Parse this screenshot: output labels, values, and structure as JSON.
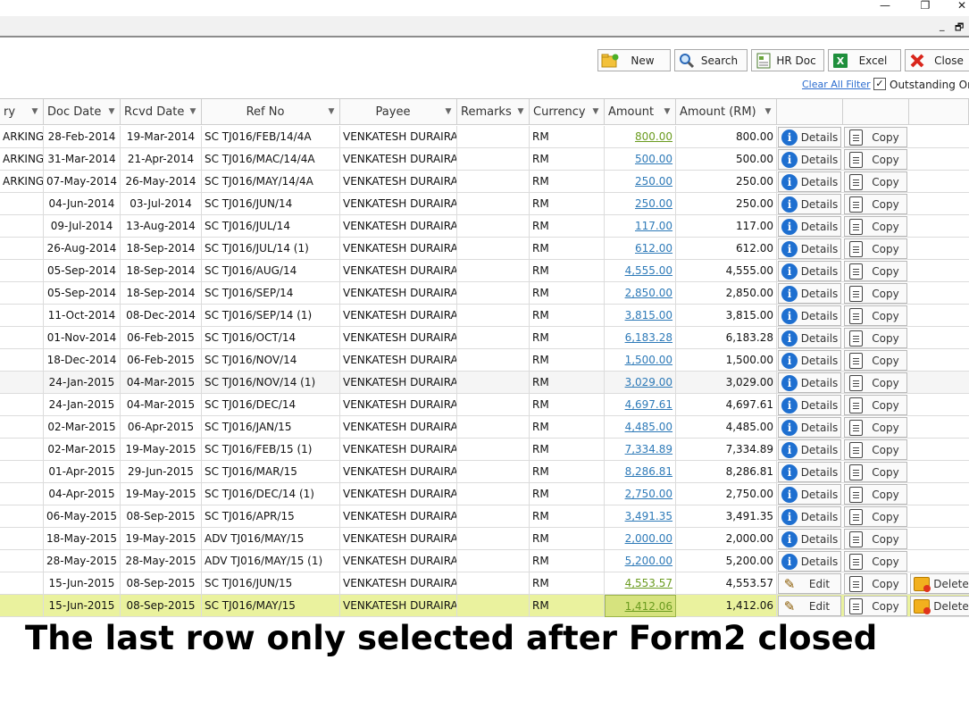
{
  "window": {
    "minimize": "—",
    "restore": "❐",
    "close": "✕",
    "mdi_minimize": "_",
    "mdi_restore": "🗗"
  },
  "toolbar": {
    "new_label": "New",
    "search_label": "Search",
    "hrdoc_label": "HR Doc",
    "excel_label": "Excel",
    "close_label": "Close"
  },
  "filter": {
    "clear_label": "Clear All Filter",
    "outstanding_label": "Outstanding Only",
    "outstanding_checked": "✓"
  },
  "columns": [
    {
      "key": "status",
      "label": "ry"
    },
    {
      "key": "doc_date",
      "label": "Doc Date"
    },
    {
      "key": "rcvd_date",
      "label": "Rcvd Date"
    },
    {
      "key": "ref_no",
      "label": "Ref No"
    },
    {
      "key": "payee",
      "label": "Payee"
    },
    {
      "key": "remarks",
      "label": "Remarks"
    },
    {
      "key": "currency",
      "label": "Currency"
    },
    {
      "key": "amount",
      "label": "Amount"
    },
    {
      "key": "amount_rm",
      "label": "Amount (RM)"
    }
  ],
  "buttons": {
    "details": "Details",
    "copy": "Copy",
    "edit": "Edit",
    "delete": "Delete"
  },
  "rows": [
    {
      "status": "ARKING",
      "doc_date": "28-Feb-2014",
      "rcvd_date": "19-Mar-2014",
      "ref_no": "SC TJ016/FEB/14/4A",
      "payee": "VENKATESH DURAIRAJ",
      "remarks": "",
      "currency": "RM",
      "amount": "800.00",
      "amount_rm": "800.00",
      "action": "Details",
      "can_delete": false
    },
    {
      "status": "ARKING",
      "doc_date": "31-Mar-2014",
      "rcvd_date": "21-Apr-2014",
      "ref_no": "SC TJ016/MAC/14/4A",
      "payee": "VENKATESH DURAIRAJ",
      "remarks": "",
      "currency": "RM",
      "amount": "500.00",
      "amount_rm": "500.00",
      "action": "Details",
      "can_delete": false
    },
    {
      "status": "ARKING",
      "doc_date": "07-May-2014",
      "rcvd_date": "26-May-2014",
      "ref_no": "SC TJ016/MAY/14/4A",
      "payee": "VENKATESH DURAIRAJ",
      "remarks": "",
      "currency": "RM",
      "amount": "250.00",
      "amount_rm": "250.00",
      "action": "Details",
      "can_delete": false
    },
    {
      "status": "",
      "doc_date": "04-Jun-2014",
      "rcvd_date": "03-Jul-2014",
      "ref_no": "SC TJ016/JUN/14",
      "payee": "VENKATESH DURAIRAJ",
      "remarks": "",
      "currency": "RM",
      "amount": "250.00",
      "amount_rm": "250.00",
      "action": "Details",
      "can_delete": false
    },
    {
      "status": "",
      "doc_date": "09-Jul-2014",
      "rcvd_date": "13-Aug-2014",
      "ref_no": "SC TJ016/JUL/14",
      "payee": "VENKATESH DURAIRAJ",
      "remarks": "",
      "currency": "RM",
      "amount": "117.00",
      "amount_rm": "117.00",
      "action": "Details",
      "can_delete": false
    },
    {
      "status": "",
      "doc_date": "26-Aug-2014",
      "rcvd_date": "18-Sep-2014",
      "ref_no": "SC TJ016/JUL/14 (1)",
      "payee": "VENKATESH DURAIRAJ",
      "remarks": "",
      "currency": "RM",
      "amount": "612.00",
      "amount_rm": "612.00",
      "action": "Details",
      "can_delete": false
    },
    {
      "status": "",
      "doc_date": "05-Sep-2014",
      "rcvd_date": "18-Sep-2014",
      "ref_no": "SC TJ016/AUG/14",
      "payee": "VENKATESH DURAIRAJ",
      "remarks": "",
      "currency": "RM",
      "amount": "4,555.00",
      "amount_rm": "4,555.00",
      "action": "Details",
      "can_delete": false
    },
    {
      "status": "",
      "doc_date": "05-Sep-2014",
      "rcvd_date": "18-Sep-2014",
      "ref_no": "SC TJ016/SEP/14",
      "payee": "VENKATESH DURAIRAJ",
      "remarks": "",
      "currency": "RM",
      "amount": "2,850.00",
      "amount_rm": "2,850.00",
      "action": "Details",
      "can_delete": false
    },
    {
      "status": "",
      "doc_date": "11-Oct-2014",
      "rcvd_date": "08-Dec-2014",
      "ref_no": "SC TJ016/SEP/14 (1)",
      "payee": "VENKATESH DURAIRAJ",
      "remarks": "",
      "currency": "RM",
      "amount": "3,815.00",
      "amount_rm": "3,815.00",
      "action": "Details",
      "can_delete": false
    },
    {
      "status": "",
      "doc_date": "01-Nov-2014",
      "rcvd_date": "06-Feb-2015",
      "ref_no": "SC TJ016/OCT/14",
      "payee": "VENKATESH DURAIRAJ",
      "remarks": "",
      "currency": "RM",
      "amount": "6,183.28",
      "amount_rm": "6,183.28",
      "action": "Details",
      "can_delete": false
    },
    {
      "status": "",
      "doc_date": "18-Dec-2014",
      "rcvd_date": "06-Feb-2015",
      "ref_no": "SC TJ016/NOV/14",
      "payee": "VENKATESH DURAIRAJ",
      "remarks": "",
      "currency": "RM",
      "amount": "1,500.00",
      "amount_rm": "1,500.00",
      "action": "Details",
      "can_delete": false
    },
    {
      "status": "",
      "doc_date": "24-Jan-2015",
      "rcvd_date": "04-Mar-2015",
      "ref_no": "SC TJ016/NOV/14 (1)",
      "payee": "VENKATESH DURAIRAJ",
      "remarks": "",
      "currency": "RM",
      "amount": "3,029.00",
      "amount_rm": "3,029.00",
      "action": "Details",
      "can_delete": false
    },
    {
      "status": "",
      "doc_date": "24-Jan-2015",
      "rcvd_date": "04-Mar-2015",
      "ref_no": "SC TJ016/DEC/14",
      "payee": "VENKATESH DURAIRAJ",
      "remarks": "",
      "currency": "RM",
      "amount": "4,697.61",
      "amount_rm": "4,697.61",
      "action": "Details",
      "can_delete": false
    },
    {
      "status": "",
      "doc_date": "02-Mar-2015",
      "rcvd_date": "06-Apr-2015",
      "ref_no": "SC TJ016/JAN/15",
      "payee": "VENKATESH DURAIRAJ",
      "remarks": "",
      "currency": "RM",
      "amount": "4,485.00",
      "amount_rm": "4,485.00",
      "action": "Details",
      "can_delete": false
    },
    {
      "status": "",
      "doc_date": "02-Mar-2015",
      "rcvd_date": "19-May-2015",
      "ref_no": "SC TJ016/FEB/15 (1)",
      "payee": "VENKATESH DURAIRAJ",
      "remarks": "",
      "currency": "RM",
      "amount": "7,334.89",
      "amount_rm": "7,334.89",
      "action": "Details",
      "can_delete": false
    },
    {
      "status": "",
      "doc_date": "01-Apr-2015",
      "rcvd_date": "29-Jun-2015",
      "ref_no": "SC TJ016/MAR/15",
      "payee": "VENKATESH DURAIRAJ",
      "remarks": "",
      "currency": "RM",
      "amount": "8,286.81",
      "amount_rm": "8,286.81",
      "action": "Details",
      "can_delete": false
    },
    {
      "status": "",
      "doc_date": "04-Apr-2015",
      "rcvd_date": "19-May-2015",
      "ref_no": "SC TJ016/DEC/14 (1)",
      "payee": "VENKATESH DURAIRAJ",
      "remarks": "",
      "currency": "RM",
      "amount": "2,750.00",
      "amount_rm": "2,750.00",
      "action": "Details",
      "can_delete": false
    },
    {
      "status": "",
      "doc_date": "06-May-2015",
      "rcvd_date": "08-Sep-2015",
      "ref_no": "SC TJ016/APR/15",
      "payee": "VENKATESH DURAIRAJ",
      "remarks": "",
      "currency": "RM",
      "amount": "3,491.35",
      "amount_rm": "3,491.35",
      "action": "Details",
      "can_delete": false
    },
    {
      "status": "",
      "doc_date": "18-May-2015",
      "rcvd_date": "19-May-2015",
      "ref_no": "ADV TJ016/MAY/15",
      "payee": "VENKATESH DURAIRAJ",
      "remarks": "",
      "currency": "RM",
      "amount": "2,000.00",
      "amount_rm": "2,000.00",
      "action": "Details",
      "can_delete": false
    },
    {
      "status": "",
      "doc_date": "28-May-2015",
      "rcvd_date": "28-May-2015",
      "ref_no": "ADV TJ016/MAY/15 (1)",
      "payee": "VENKATESH DURAIRAJ",
      "remarks": "",
      "currency": "RM",
      "amount": "5,200.00",
      "amount_rm": "5,200.00",
      "action": "Details",
      "can_delete": false
    },
    {
      "status": "",
      "doc_date": "15-Jun-2015",
      "rcvd_date": "08-Sep-2015",
      "ref_no": "SC TJ016/JUN/15",
      "payee": "VENKATESH DURAIRAJ",
      "remarks": "",
      "currency": "RM",
      "amount": "4,553.57",
      "amount_rm": "4,553.57",
      "action": "Edit",
      "can_delete": true
    },
    {
      "status": "",
      "doc_date": "15-Jun-2015",
      "rcvd_date": "08-Sep-2015",
      "ref_no": "SC TJ016/MAY/15",
      "payee": "VENKATESH DURAIRAJ",
      "remarks": "",
      "currency": "RM",
      "amount": "1,412.06",
      "amount_rm": "1,412.06",
      "action": "Edit",
      "can_delete": true,
      "selected": true
    }
  ],
  "caption": "The last row only selected after Form2 closed",
  "colors": {
    "selected_row": "#eaf29e",
    "link": "#2e7ab8",
    "link_green": "#6a9b1f",
    "info_icon": "#1e6fd0"
  }
}
